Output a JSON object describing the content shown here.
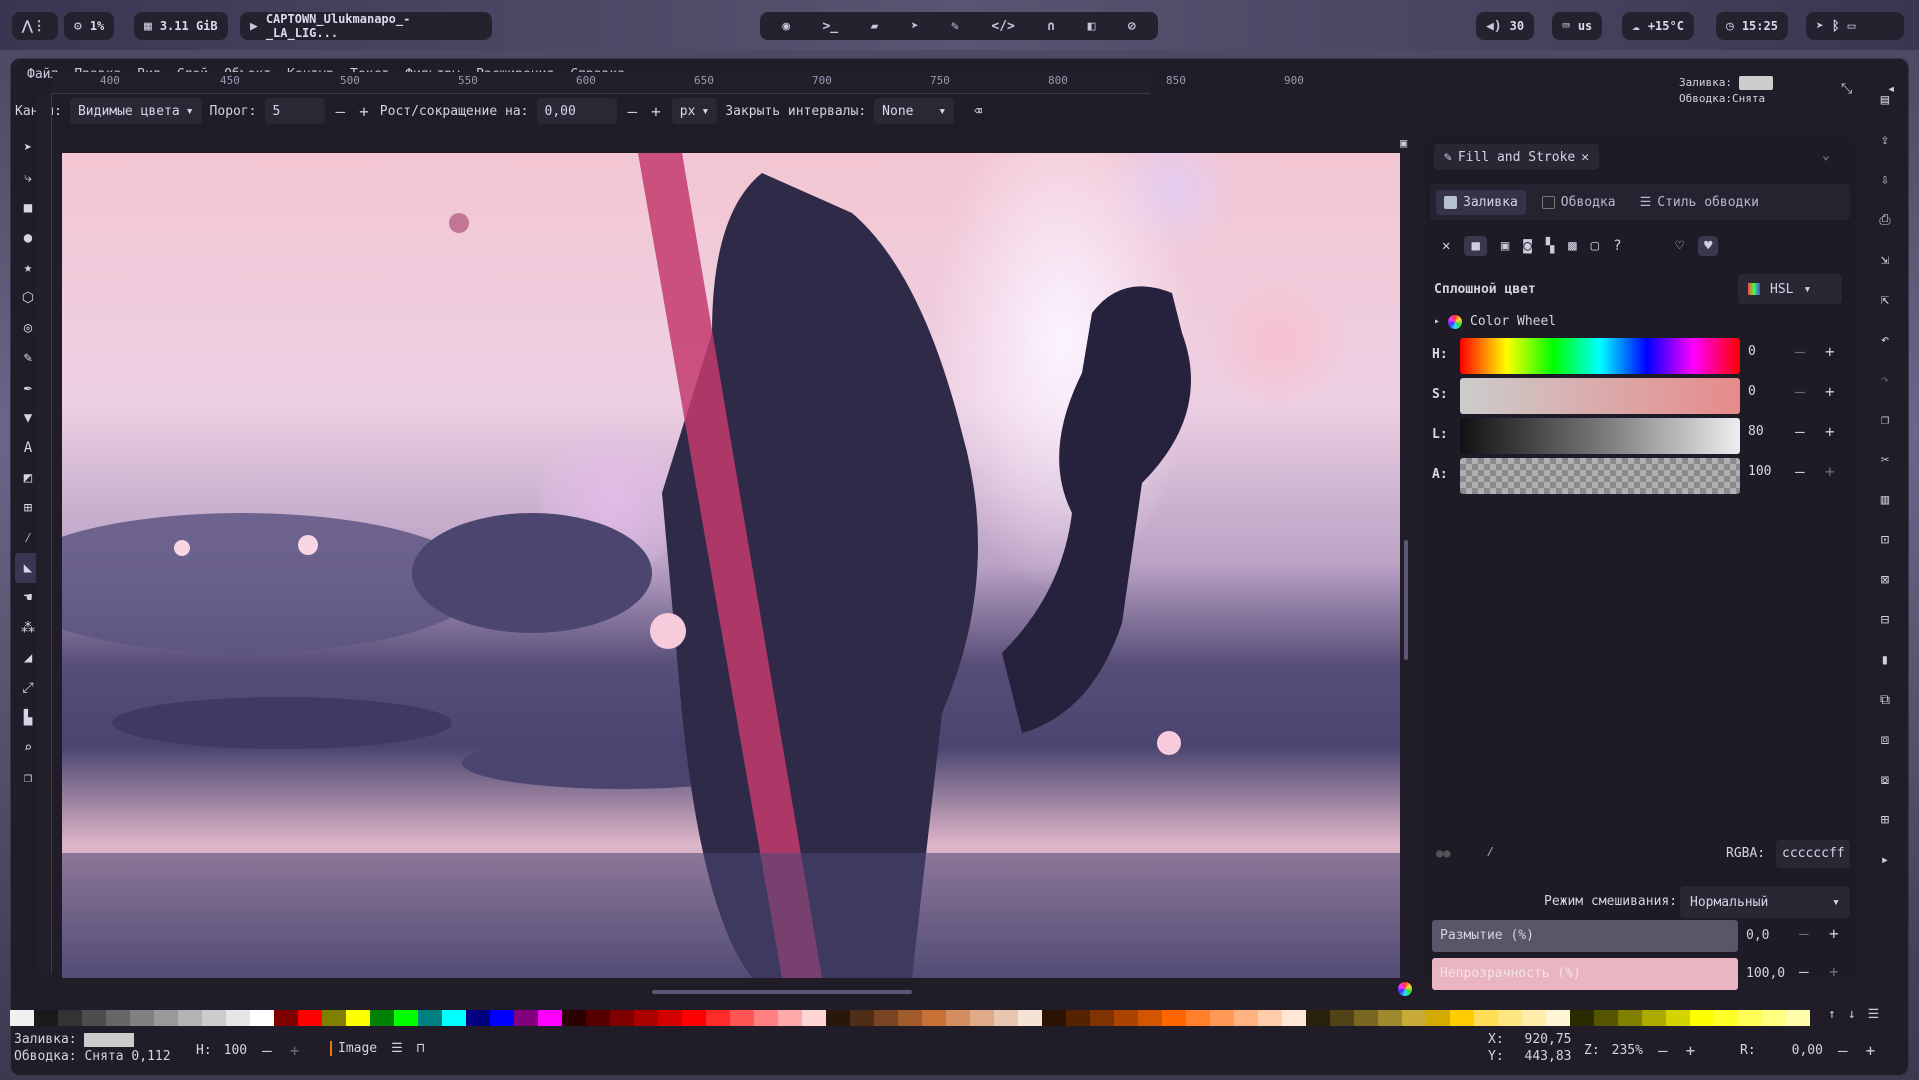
{
  "sysbar": {
    "cpu": "1%",
    "mem": "3.11 GiB",
    "media": "CAPTOWN_Ulukmanapo_-_LA_LIG...",
    "volume": "30",
    "kbd": "us",
    "weather": "+15°C",
    "clock": "15:25"
  },
  "menu": [
    "Файл",
    "Правка",
    "Вид",
    "Слой",
    "Объект",
    "Контур",
    "Текст",
    "Фильтры",
    "Расширения",
    "Справка"
  ],
  "ctrl": {
    "channel_label": "Канал:",
    "channel_value": "Видимые цвета",
    "threshold_label": "Порог:",
    "threshold_value": "5",
    "grow_label": "Рост/сокращение на:",
    "grow_value": "0,00",
    "unit": "px",
    "close_gaps_label": "Закрыть интервалы:",
    "close_gaps_value": "None"
  },
  "style_indicator": {
    "fill_label": "Заливка:",
    "stroke_label": "Обводка:",
    "stroke_value": "Снята"
  },
  "ruler_ticks": [
    "400",
    "450",
    "500",
    "550",
    "600",
    "650",
    "700",
    "750",
    "800",
    "850",
    "900"
  ],
  "panel": {
    "tab_title": "Fill and Stroke",
    "subtabs": [
      "Заливка",
      "Обводка",
      "Стиль обводки"
    ],
    "mode_title": "Сплошной цвет",
    "color_model": "HSL",
    "wheel_label": "Color Wheel",
    "channels": [
      {
        "name": "H:",
        "value": "0"
      },
      {
        "name": "S:",
        "value": "0"
      },
      {
        "name": "L:",
        "value": "80"
      },
      {
        "name": "A:",
        "value": "100"
      }
    ],
    "rgba_label": "RGBA:",
    "rgba_value": "ccccccff",
    "blend_label": "Режим смешивания:",
    "blend_value": "Нормальный",
    "blur_label": "Размытие (%)",
    "blur_value": "0,0",
    "opacity_label": "Непрозрачность (%)",
    "opacity_value": "100,0"
  },
  "status": {
    "fill_label": "Заливка:",
    "stroke_label": "Обводка:",
    "stroke_value": "Снята",
    "stroke_width": "0,112",
    "h_label": "H:",
    "h_value": "100",
    "layer": "Image",
    "x_label": "X:",
    "x_value": "920,75",
    "y_label": "Y:",
    "y_value": "443,83",
    "zoom_label": "Z:",
    "zoom_value": "235%",
    "rot_label": "R:",
    "rot_value": "0,00"
  },
  "colors": {
    "accent": "#8f86c8",
    "fill": "#cccccc",
    "panel_bg": "#1e1b26"
  },
  "palette": [
    "#f0f0f0",
    "#1a1a1a",
    "#333333",
    "#4d4d4d",
    "#666666",
    "#808080",
    "#999999",
    "#b3b3b3",
    "#cccccc",
    "#e6e6e6",
    "#ffffff",
    "#800000",
    "#ff0000",
    "#808000",
    "#ffff00",
    "#008000",
    "#00ff00",
    "#008080",
    "#00ffff",
    "#000080",
    "#0000ff",
    "#800080",
    "#ff00ff",
    "#2b0000",
    "#550000",
    "#800000",
    "#aa0000",
    "#d40000",
    "#ff0000",
    "#ff2a2a",
    "#ff5555",
    "#ff8080",
    "#ffaaaa",
    "#ffd5d5",
    "#28170b",
    "#502d16",
    "#784421",
    "#a05a2c",
    "#c87137",
    "#d38d5f",
    "#deaa87",
    "#e9c6af",
    "#f4e3d7",
    "#2b1100",
    "#552200",
    "#803300",
    "#aa4400",
    "#d45500",
    "#ff6600",
    "#ff7f2a",
    "#ff9955",
    "#ffb380",
    "#ffccaa",
    "#ffe6d5",
    "#28220b",
    "#504416",
    "#786721",
    "#a0892c",
    "#c8ab37",
    "#d4aa00",
    "#ffcc00",
    "#ffdd55",
    "#ffe680",
    "#ffeeaa",
    "#fff6d5",
    "#2b2b00",
    "#555500",
    "#808000",
    "#aaaa00",
    "#d4d400",
    "#ffff00",
    "#ffff2a",
    "#ffff55",
    "#ffff80",
    "#ffffaa"
  ]
}
